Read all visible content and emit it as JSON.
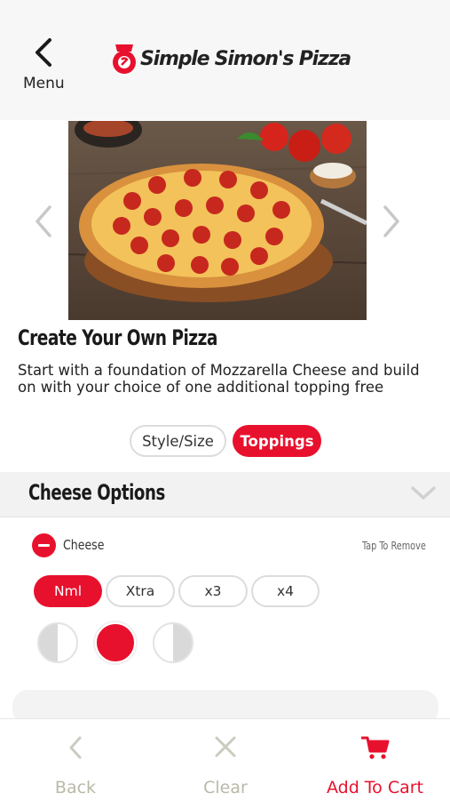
{
  "header": {
    "back_label": "Menu",
    "brand": "Simple Simon's Pizza"
  },
  "product": {
    "title": "Create Your Own Pizza",
    "description": "Start with a foundation of Mozzarella Cheese and build on with your choice of one additional topping free"
  },
  "tabs": [
    {
      "label": "Style/Size",
      "active": false
    },
    {
      "label": "Toppings",
      "active": true
    }
  ],
  "section": {
    "title": "Cheese Options",
    "option_name": "Cheese",
    "tap_hint": "Tap To Remove",
    "amounts": [
      {
        "label": "Nml",
        "active": true
      },
      {
        "label": "Xtra",
        "active": false
      },
      {
        "label": "x3",
        "active": false
      },
      {
        "label": "x4",
        "active": false
      }
    ],
    "portions": [
      "left-half",
      "whole",
      "right-half"
    ],
    "selected_portion": "whole"
  },
  "bottom_bar": {
    "back_label": "Back",
    "clear_label": "Clear",
    "cart_label": "Add To Cart"
  },
  "colors": {
    "accent": "#e8112d",
    "disabled_text": "#b9b9a8",
    "header_bg": "#f7f7f7"
  }
}
